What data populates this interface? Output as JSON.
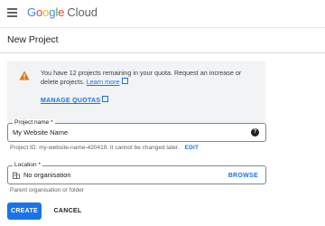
{
  "brand": {
    "google": "Google",
    "product": "Cloud"
  },
  "header": {
    "title": "New Project"
  },
  "quota": {
    "message": "You have 12 projects remaining in your quota. Request an increase or delete projects.",
    "learn_more": "Learn more",
    "manage_quotas": "MANAGE QUOTAS",
    "icon": "warning-icon",
    "icon_color": "#e37400"
  },
  "project_name": {
    "label": "Project name *",
    "value": "My Website Name",
    "help_icon": "help-icon",
    "project_id_text": "Project ID: my-website-name-420419. It cannot be changed later.",
    "edit_label": "EDIT"
  },
  "location": {
    "label": "Location *",
    "value": "No organisation",
    "browse_label": "BROWSE",
    "hint": "Parent organisation or folder",
    "icon": "organization-icon"
  },
  "actions": {
    "create": "CREATE",
    "cancel": "CANCEL"
  },
  "colors": {
    "accent": "#1a73e8",
    "box_bg": "#f1f3f4"
  }
}
